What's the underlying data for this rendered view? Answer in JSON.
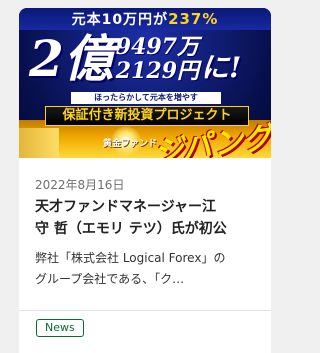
{
  "card": {
    "banner": {
      "head_prefix": "元本10万円が",
      "head_pct": "237%",
      "oku": "2億",
      "line1": "9497万",
      "line2": "2129円",
      "ni": "に!",
      "sub_strip": "ほったらかして元本を増やす",
      "project": "保証付き新投資プロジェクト",
      "sub_logo": "黄金ファンド",
      "logo": "ジパング"
    },
    "date": "2022年8月16日",
    "title_lines": [
      "天才ファンドマネージャー江",
      "守 哲（エモリ テツ）氏が初公"
    ],
    "excerpt_lines": [
      "弊社「株式会社 Logical Forex」の",
      "グループ会社である、「ク…"
    ],
    "tag": "News"
  }
}
